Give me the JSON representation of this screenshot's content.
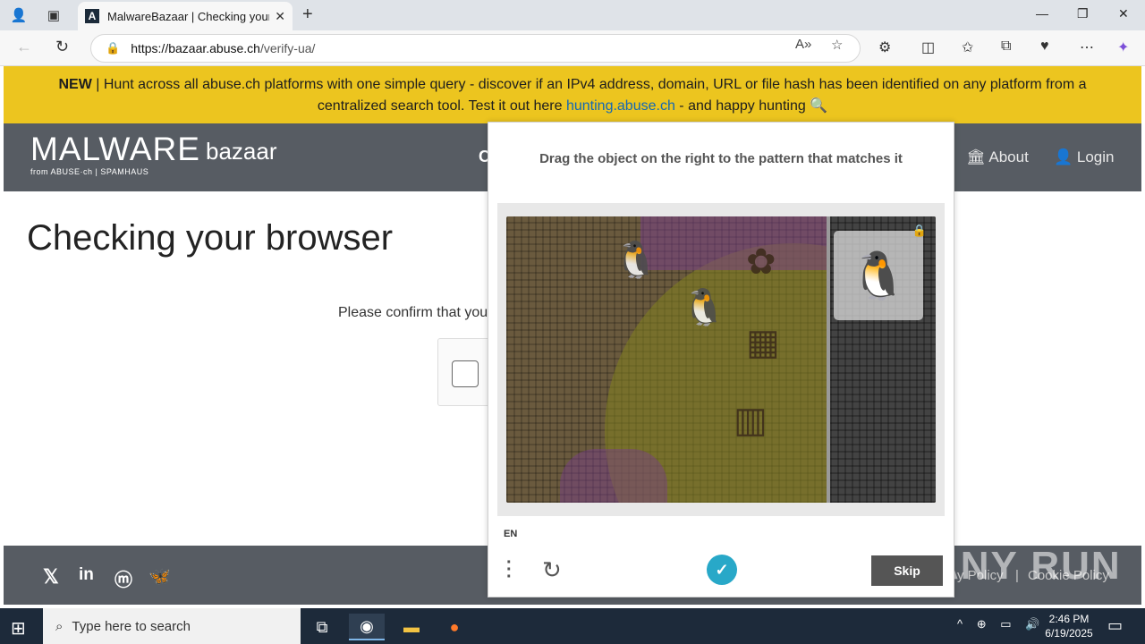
{
  "browser": {
    "tab_title": "MalwareBazaar | Checking your b",
    "tab_favicon": "A",
    "url_domain": "https://bazaar.abuse.ch",
    "url_path": "/verify-ua/"
  },
  "banner": {
    "new_label": "NEW",
    "text_before": " | Hunt across all abuse.ch platforms with one simple query - discover if an IPv4 address, domain, URL or file hash has been identified on any platform from a centralized search tool. Test it out here ",
    "link_text": "hunting.abuse.ch",
    "text_after": " - and happy hunting 🔍"
  },
  "header": {
    "logo_main": "MALWARE",
    "logo_sub": "bazaar",
    "logo_from": "from ABUSE·ch | SPAMHAUS",
    "nav_partial": "C",
    "nav_about": "About",
    "nav_login": "Login"
  },
  "content": {
    "title": "Checking your browser",
    "confirm_text": "Please confirm that you"
  },
  "footer": {
    "privacy_partial": "y Policy",
    "separator": "|",
    "cookie_partial": "Cookie Policy"
  },
  "captcha": {
    "prompt": "Drag the object on the right to the pattern that matches it",
    "language": "EN",
    "skip_label": "Skip"
  },
  "watermark": "ANY RUN",
  "taskbar": {
    "search_placeholder": "Type here to search",
    "time": "2:46 PM",
    "date": "6/19/2025"
  }
}
